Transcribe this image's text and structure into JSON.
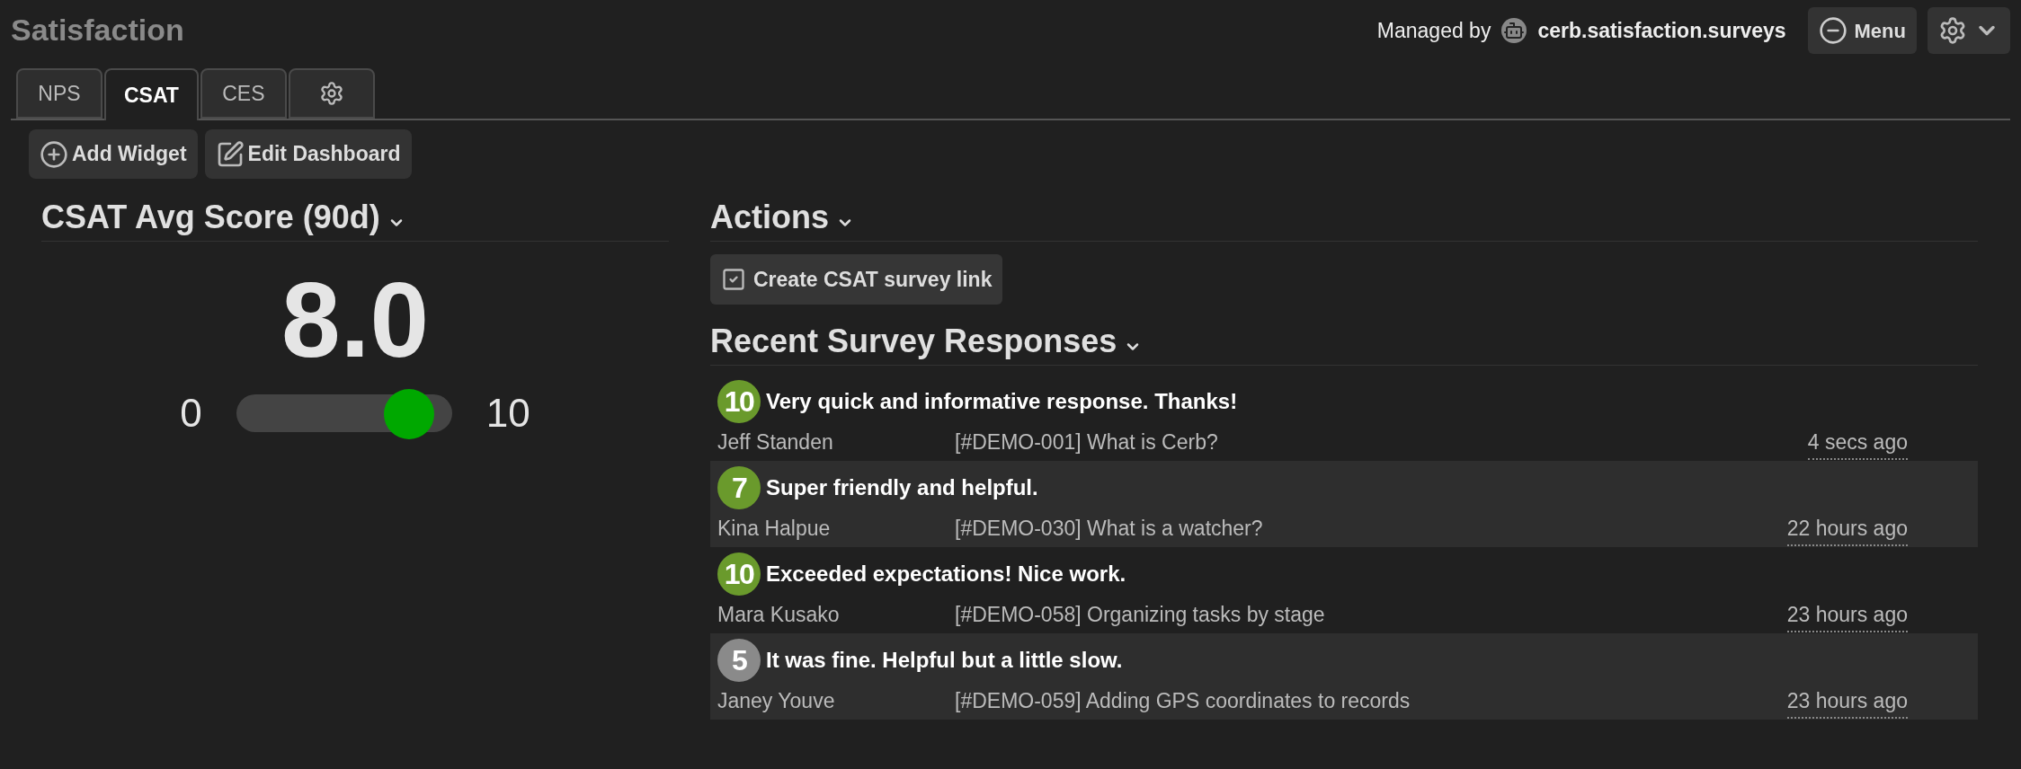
{
  "page_title": "Satisfaction",
  "managed_by": {
    "label": "Managed by",
    "owner": "cerb.satisfaction.surveys"
  },
  "header_buttons": {
    "menu": "Menu"
  },
  "tabs": [
    {
      "label": "NPS",
      "selected": false,
      "kind": "text"
    },
    {
      "label": "CSAT",
      "selected": true,
      "kind": "text"
    },
    {
      "label": "CES",
      "selected": false,
      "kind": "text"
    },
    {
      "selected": false,
      "kind": "gear"
    }
  ],
  "toolbar": [
    {
      "label": "Add Widget",
      "kind": "add"
    },
    {
      "label": "Edit Dashboard",
      "kind": "edit"
    }
  ],
  "score_widget": {
    "title": "CSAT Avg Score (90d)",
    "score": "8.0",
    "min": "0",
    "max": "10",
    "level": 0.8
  },
  "actions_widget": {
    "title": "Actions",
    "buttons": [
      "Create CSAT survey link"
    ]
  },
  "responses_widget": {
    "title": "Recent Survey Responses",
    "responses": [
      {
        "score": "10",
        "color": "#6a9a2c",
        "comment": "Very quick and informative response. Thanks!",
        "name": "Jeff Standen",
        "ticket": "[#DEMO-001] What is Cerb?",
        "time": "4 secs ago"
      },
      {
        "score": "7",
        "color": "#6a9a2c",
        "comment": "Super friendly and helpful.",
        "name": "Kina Halpue",
        "ticket": "[#DEMO-030] What is a watcher?",
        "time": "22 hours ago"
      },
      {
        "score": "10",
        "color": "#6a9a2c",
        "comment": "Exceeded expectations! Nice work.",
        "name": "Mara Kusako",
        "ticket": "[#DEMO-058] Organizing tasks by stage",
        "time": "23 hours ago"
      },
      {
        "score": "5",
        "color": "#8a8a8a",
        "comment": "It was fine. Helpful but a little slow.",
        "name": "Janey Youve",
        "ticket": "[#DEMO-059] Adding GPS coordinates to records",
        "time": "23 hours ago"
      }
    ]
  }
}
